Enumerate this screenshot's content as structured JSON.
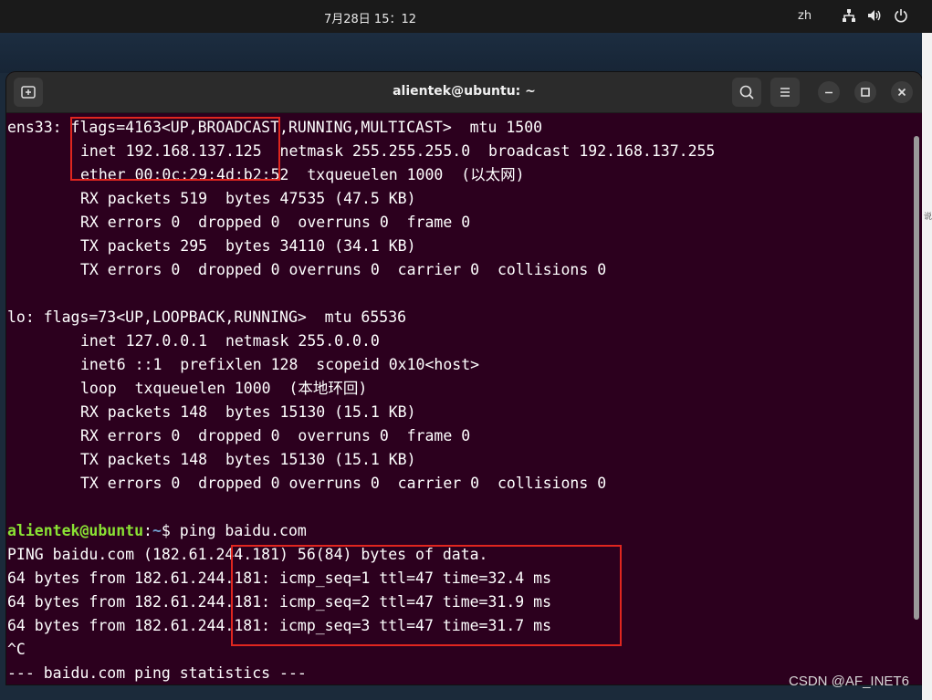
{
  "topbar": {
    "clock": "7月28日  15：12",
    "language": "zh",
    "icons": [
      "network-icon",
      "volume-icon",
      "power-icon"
    ]
  },
  "window": {
    "title": "alientek@ubuntu: ~",
    "buttons": [
      "new-tab-icon",
      "search-icon",
      "menu-icon",
      "minimize-icon",
      "maximize-icon",
      "close-icon"
    ]
  },
  "terminal": {
    "lines": [
      {
        "indent": false,
        "text": "ens33: flags=4163<UP,BROADCAST,RUNNING,MULTICAST>  mtu 1500"
      },
      {
        "indent": true,
        "text": "inet 192.168.137.125  netmask 255.255.255.0  broadcast 192.168.137.255"
      },
      {
        "indent": true,
        "text": "ether 00:0c:29:4d:b2:52  txqueuelen 1000  (以太网)"
      },
      {
        "indent": true,
        "text": "RX packets 519  bytes 47535 (47.5 KB)"
      },
      {
        "indent": true,
        "text": "RX errors 0  dropped 0  overruns 0  frame 0"
      },
      {
        "indent": true,
        "text": "TX packets 295  bytes 34110 (34.1 KB)"
      },
      {
        "indent": true,
        "text": "TX errors 0  dropped 0 overruns 0  carrier 0  collisions 0"
      },
      {
        "indent": false,
        "text": ""
      },
      {
        "indent": false,
        "text": "lo: flags=73<UP,LOOPBACK,RUNNING>  mtu 65536"
      },
      {
        "indent": true,
        "text": "inet 127.0.0.1  netmask 255.0.0.0"
      },
      {
        "indent": true,
        "text": "inet6 ::1  prefixlen 128  scopeid 0x10<host>"
      },
      {
        "indent": true,
        "text": "loop  txqueuelen 1000  (本地环回)"
      },
      {
        "indent": true,
        "text": "RX packets 148  bytes 15130 (15.1 KB)"
      },
      {
        "indent": true,
        "text": "RX errors 0  dropped 0  overruns 0  frame 0"
      },
      {
        "indent": true,
        "text": "TX packets 148  bytes 15130 (15.1 KB)"
      },
      {
        "indent": true,
        "text": "TX errors 0  dropped 0 overruns 0  carrier 0  collisions 0"
      },
      {
        "indent": false,
        "text": ""
      }
    ],
    "prompt": {
      "user": "alientek@ubuntu",
      "sep": ":",
      "path": "~",
      "symbol": "$ ",
      "command": "ping baidu.com"
    },
    "output": [
      "PING baidu.com (182.61.244.181) 56(84) bytes of data.",
      "64 bytes from 182.61.244.181: icmp_seq=1 ttl=47 time=32.4 ms",
      "64 bytes from 182.61.244.181: icmp_seq=2 ttl=47 time=31.9 ms",
      "64 bytes from 182.61.244.181: icmp_seq=3 ttl=47 time=31.7 ms",
      "^C",
      "--- baidu.com ping statistics ---"
    ]
  },
  "watermark": "CSDN @AF_INET6",
  "edge_text": "说",
  "colors": {
    "terminal_bg": "#2c001e",
    "prompt_user": "#8ae234",
    "prompt_path": "#729fcf",
    "highlight": "#e0261f"
  }
}
